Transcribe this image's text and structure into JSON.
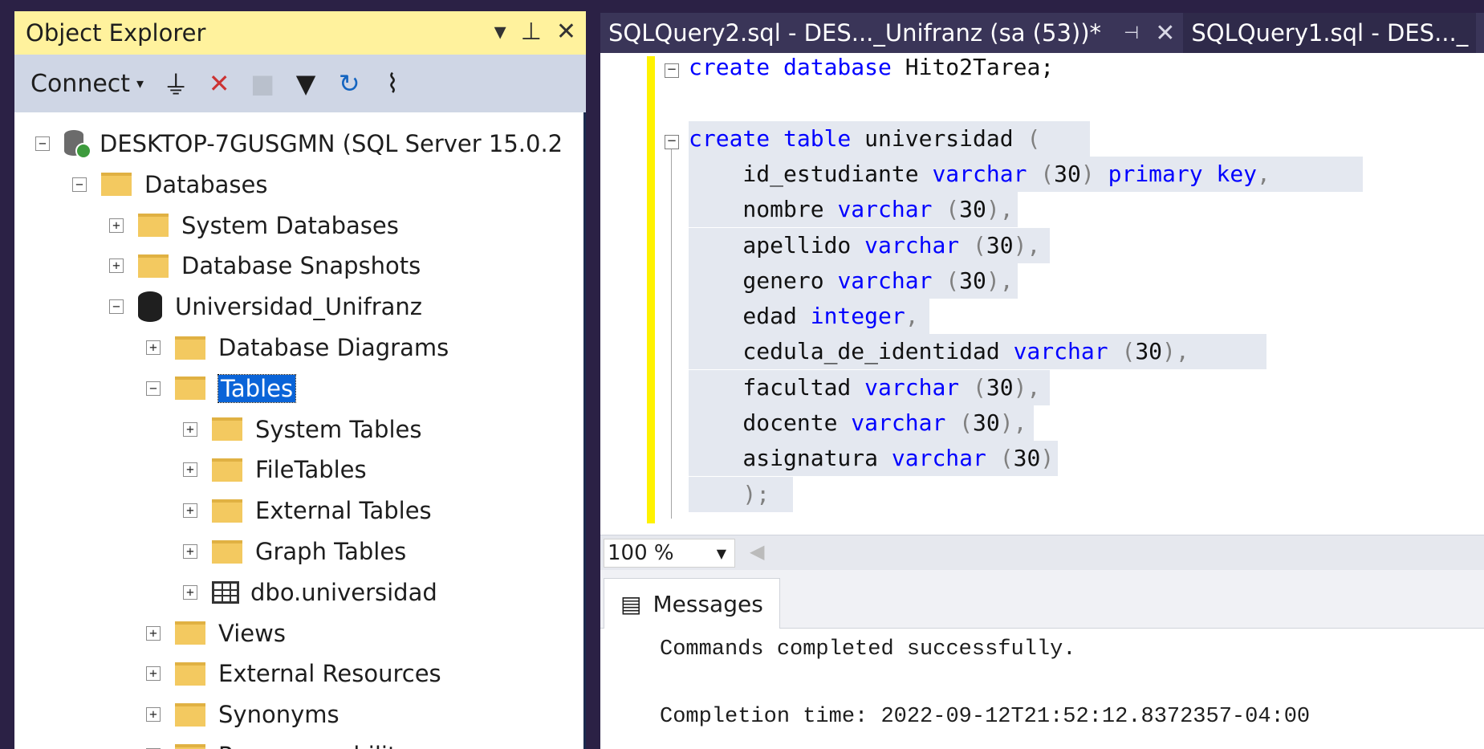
{
  "object_explorer": {
    "title": "Object Explorer",
    "title_buttons": {
      "dropdown": "▾",
      "pin": "📌",
      "close": "✕"
    },
    "toolbar": {
      "connect_label": "Connect",
      "connect_caret": "▾"
    },
    "tree": [
      {
        "label": "DESKTOP-7GUSGMN (SQL Server 15.0.2",
        "icon": "server-icon",
        "expander": "−"
      },
      {
        "label": "Databases",
        "icon": "folder-icon",
        "expander": "−"
      },
      {
        "label": "System Databases",
        "icon": "folder-icon",
        "expander": "+"
      },
      {
        "label": "Database Snapshots",
        "icon": "folder-icon",
        "expander": "+"
      },
      {
        "label": "Universidad_Unifranz",
        "icon": "database-icon",
        "expander": "−"
      },
      {
        "label": "Database Diagrams",
        "icon": "folder-icon",
        "expander": "+"
      },
      {
        "label": "Tables",
        "icon": "folder-icon",
        "expander": "−",
        "selected": true
      },
      {
        "label": "System Tables",
        "icon": "folder-icon",
        "expander": "+"
      },
      {
        "label": "FileTables",
        "icon": "folder-icon",
        "expander": "+"
      },
      {
        "label": "External Tables",
        "icon": "folder-icon",
        "expander": "+"
      },
      {
        "label": "Graph Tables",
        "icon": "folder-icon",
        "expander": "+"
      },
      {
        "label": "dbo.universidad",
        "icon": "table-icon",
        "expander": "+"
      },
      {
        "label": "Views",
        "icon": "folder-icon",
        "expander": "+"
      },
      {
        "label": "External Resources",
        "icon": "folder-icon",
        "expander": "+"
      },
      {
        "label": "Synonyms",
        "icon": "folder-icon",
        "expander": "+"
      },
      {
        "label": "Programmability",
        "icon": "folder-icon",
        "expander": "+"
      }
    ]
  },
  "tabs": [
    {
      "label": "SQLQuery2.sql - DES..._Unifranz (sa (53))*",
      "active": true
    },
    {
      "label": "SQLQuery1.sql - DES..._",
      "active": false
    }
  ],
  "editor": {
    "lines": [
      [
        {
          "t": "create database",
          "c": "kw"
        },
        {
          "t": " Hito2Tarea;",
          "c": ""
        }
      ],
      [],
      [
        {
          "t": "create table",
          "c": "kw"
        },
        {
          "t": " universidad ",
          "c": ""
        },
        {
          "t": "(",
          "c": "gy"
        }
      ],
      [
        {
          "t": "    id_estudiante ",
          "c": ""
        },
        {
          "t": "varchar",
          "c": "kw"
        },
        {
          "t": " (",
          "c": "gy"
        },
        {
          "t": "30",
          "c": ""
        },
        {
          "t": ")",
          "c": "gy"
        },
        {
          "t": " primary key",
          "c": "kw"
        },
        {
          "t": ",",
          "c": "gy"
        }
      ],
      [
        {
          "t": "    nombre ",
          "c": ""
        },
        {
          "t": "varchar",
          "c": "kw"
        },
        {
          "t": " (",
          "c": "gy"
        },
        {
          "t": "30",
          "c": ""
        },
        {
          "t": "),",
          "c": "gy"
        }
      ],
      [
        {
          "t": "    apellido ",
          "c": ""
        },
        {
          "t": "varchar",
          "c": "kw"
        },
        {
          "t": " (",
          "c": "gy"
        },
        {
          "t": "30",
          "c": ""
        },
        {
          "t": "),",
          "c": "gy"
        }
      ],
      [
        {
          "t": "    genero ",
          "c": ""
        },
        {
          "t": "varchar",
          "c": "kw"
        },
        {
          "t": " (",
          "c": "gy"
        },
        {
          "t": "30",
          "c": ""
        },
        {
          "t": "),",
          "c": "gy"
        }
      ],
      [
        {
          "t": "    edad ",
          "c": ""
        },
        {
          "t": "integer",
          "c": "kw"
        },
        {
          "t": ",",
          "c": "gy"
        }
      ],
      [
        {
          "t": "    cedula_de_identidad ",
          "c": ""
        },
        {
          "t": "varchar",
          "c": "kw"
        },
        {
          "t": " (",
          "c": "gy"
        },
        {
          "t": "30",
          "c": ""
        },
        {
          "t": "),",
          "c": "gy"
        }
      ],
      [
        {
          "t": "    facultad ",
          "c": ""
        },
        {
          "t": "varchar",
          "c": "kw"
        },
        {
          "t": " (",
          "c": "gy"
        },
        {
          "t": "30",
          "c": ""
        },
        {
          "t": "),",
          "c": "gy"
        }
      ],
      [
        {
          "t": "    docente ",
          "c": ""
        },
        {
          "t": "varchar",
          "c": "kw"
        },
        {
          "t": " (",
          "c": "gy"
        },
        {
          "t": "30",
          "c": ""
        },
        {
          "t": "),",
          "c": "gy"
        }
      ],
      [
        {
          "t": "    asignatura ",
          "c": ""
        },
        {
          "t": "varchar",
          "c": "kw"
        },
        {
          "t": " (",
          "c": "gy"
        },
        {
          "t": "30",
          "c": ""
        },
        {
          "t": ")",
          "c": "gy"
        }
      ],
      [
        {
          "t": "    );",
          "c": "gy"
        }
      ]
    ]
  },
  "zoom": {
    "value": "100 %"
  },
  "results": {
    "tab_label": "Messages",
    "line1": "Commands completed successfully.",
    "line2": "Completion time: 2022-09-12T21:52:12.8372357-04:00"
  },
  "colors": {
    "keyword": "#0000ff",
    "selection": "#0a64d8",
    "title_bar": "#fff29d",
    "accent_bg": "#2b2145"
  }
}
